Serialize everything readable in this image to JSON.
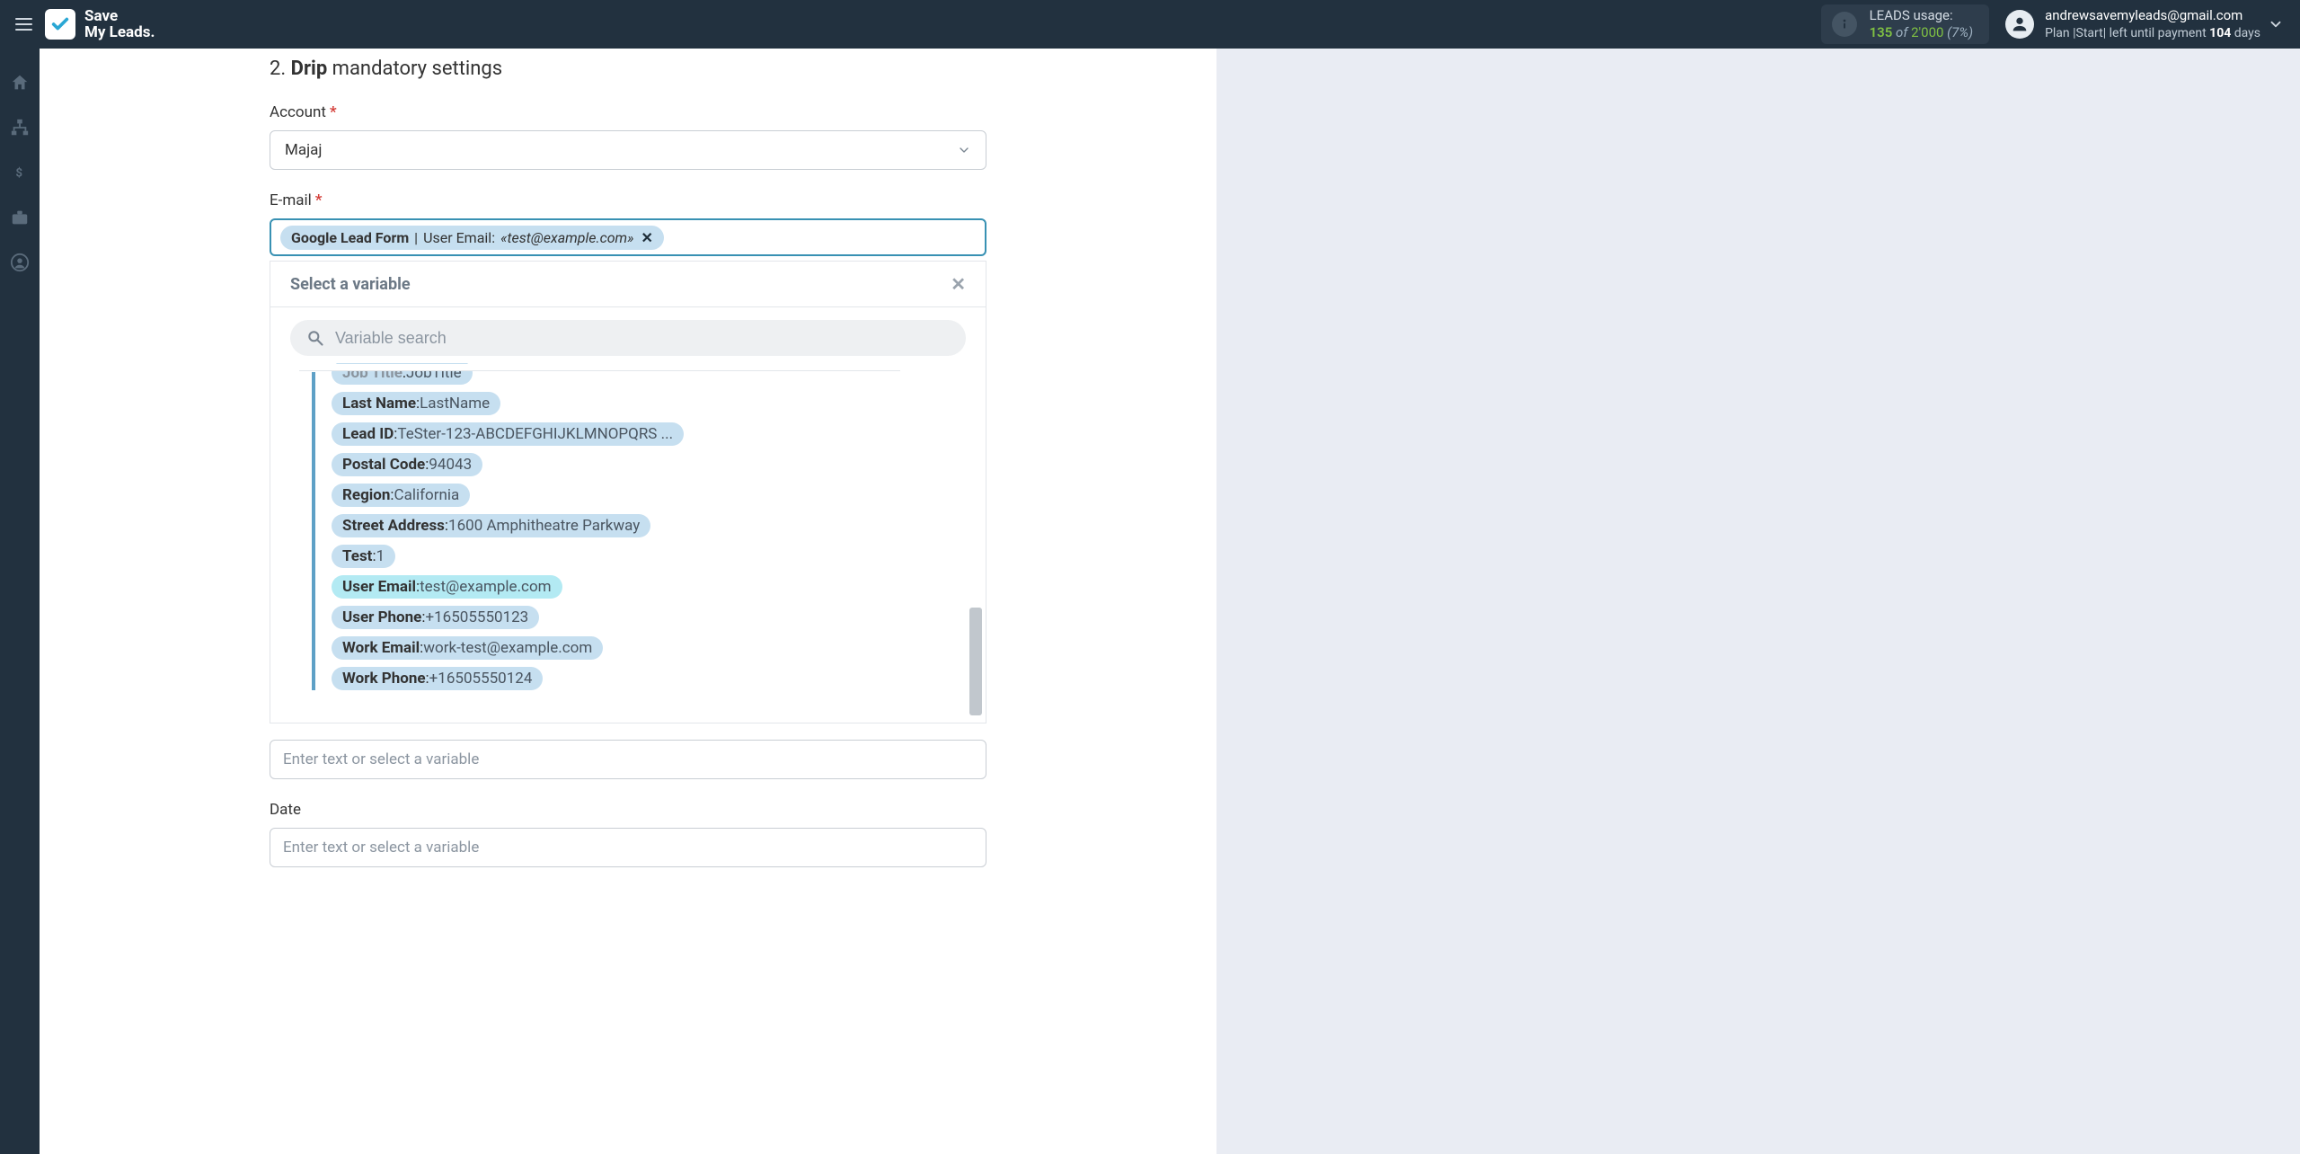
{
  "brand": {
    "line1": "Save",
    "line2": "My Leads."
  },
  "header": {
    "leads_usage_label": "LEADS usage:",
    "leads_used": "135",
    "leads_of": "of",
    "leads_total": "2'000",
    "leads_pct": "(7%)"
  },
  "user": {
    "email": "andrewsavemyleads@gmail.com",
    "plan_prefix": "Plan |Start| left until payment ",
    "plan_days_num": "104",
    "plan_days_suffix": " days"
  },
  "step": {
    "number": "2.",
    "name": "Drip",
    "rest": "mandatory settings"
  },
  "account": {
    "label": "Account",
    "value": "Majaj"
  },
  "email": {
    "label": "E-mail",
    "chip": {
      "source": "Google Lead Form",
      "separator": " | ",
      "field_label": "User Email: ",
      "value_quoted": "«test@example.com»"
    }
  },
  "dropdown": {
    "title": "Select a variable",
    "placeholder": "Variable search",
    "variables": [
      {
        "key": "Job Title",
        "value": "JobTitle",
        "cut": true
      },
      {
        "key": "Last Name",
        "value": "LastName"
      },
      {
        "key": "Lead ID",
        "value": "TeSter-123-ABCDEFGHIJKLMNOPQRS ..."
      },
      {
        "key": "Postal Code",
        "value": "94043"
      },
      {
        "key": "Region",
        "value": "California"
      },
      {
        "key": "Street Address",
        "value": "1600 Amphitheatre Parkway"
      },
      {
        "key": "Test",
        "value": "1"
      },
      {
        "key": "User Email",
        "value": "test@example.com",
        "sel": true
      },
      {
        "key": "User Phone",
        "value": "+16505550123"
      },
      {
        "key": "Work Email",
        "value": "work-test@example.com"
      },
      {
        "key": "Work Phone",
        "value": "+16505550124"
      }
    ]
  },
  "below": {
    "placeholder1": "Enter text or select a variable",
    "date_label": "Date",
    "placeholder2": "Enter text or select a variable"
  }
}
